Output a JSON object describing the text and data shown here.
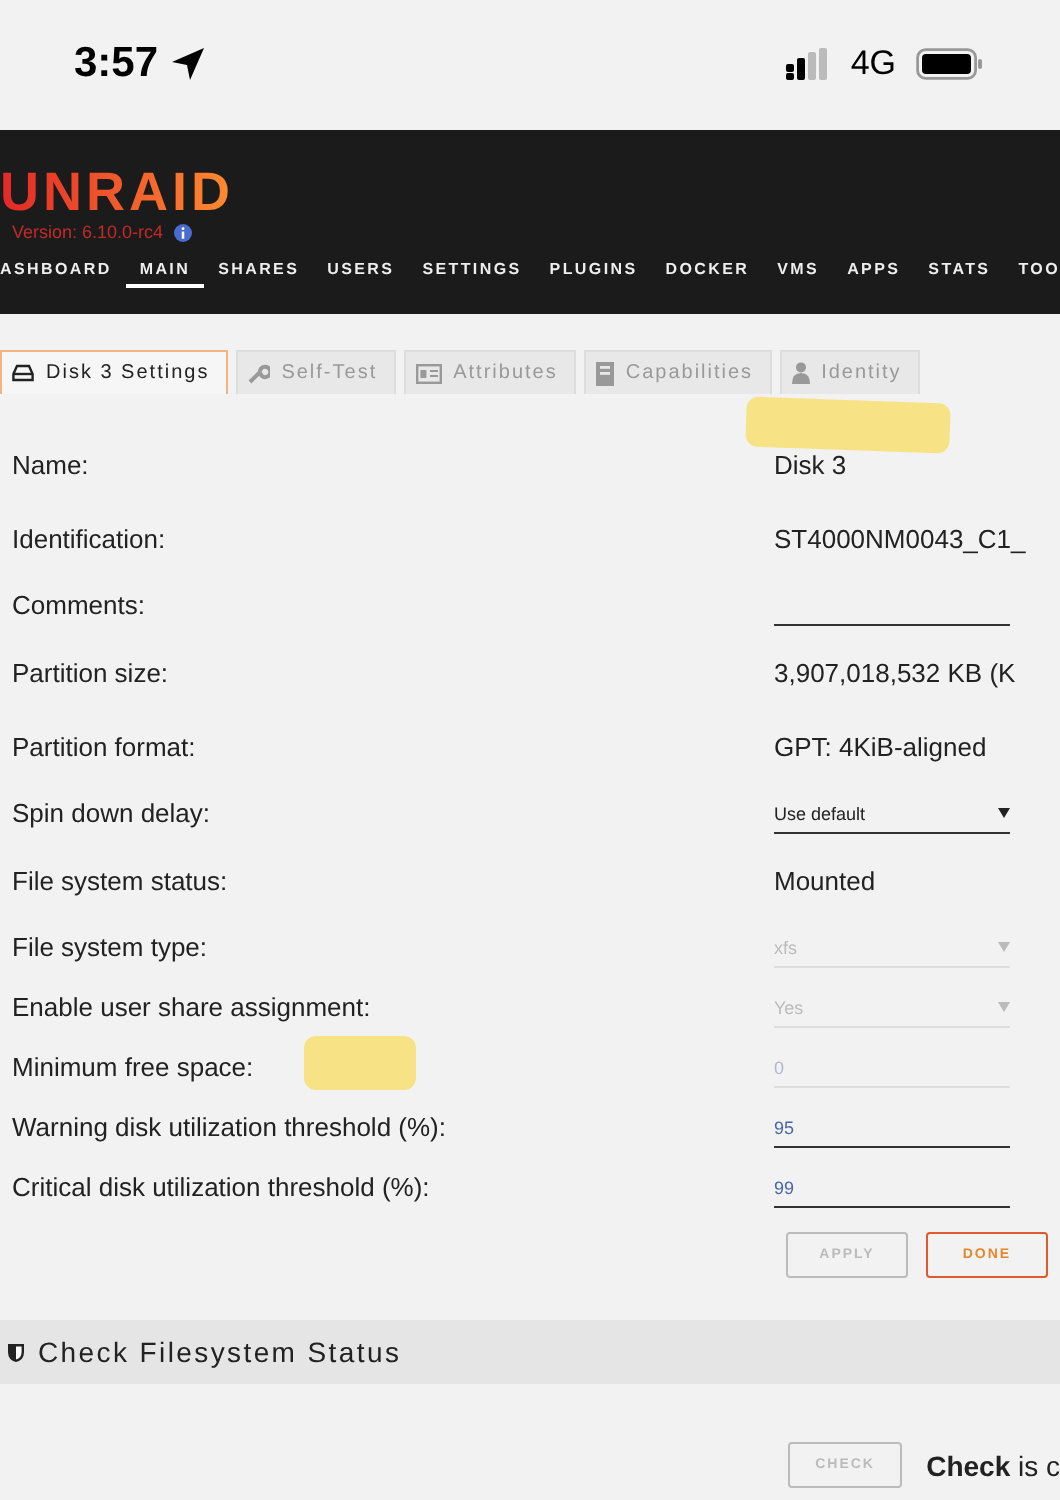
{
  "status_bar": {
    "time": "3:57",
    "network": "4G"
  },
  "header": {
    "logo": "UNRAID",
    "version": "Version: 6.10.0-rc4"
  },
  "nav": [
    {
      "label": "ASHBOARD",
      "selected": false
    },
    {
      "label": "MAIN",
      "selected": true
    },
    {
      "label": "SHARES",
      "selected": false
    },
    {
      "label": "USERS",
      "selected": false
    },
    {
      "label": "SETTINGS",
      "selected": false
    },
    {
      "label": "PLUGINS",
      "selected": false
    },
    {
      "label": "DOCKER",
      "selected": false
    },
    {
      "label": "VMS",
      "selected": false
    },
    {
      "label": "APPS",
      "selected": false
    },
    {
      "label": "STATS",
      "selected": false
    },
    {
      "label": "TOO",
      "selected": false
    }
  ],
  "tabs": [
    {
      "label": "Disk 3 Settings",
      "kind": "drive",
      "selected": true
    },
    {
      "label": "Self-Test",
      "kind": "wrench",
      "selected": false
    },
    {
      "label": "Attributes",
      "kind": "card",
      "selected": false
    },
    {
      "label": "Capabilities",
      "kind": "server",
      "selected": false
    },
    {
      "label": "Identity",
      "kind": "user",
      "selected": false
    }
  ],
  "settings": [
    {
      "label": "Name:",
      "kind": "text",
      "value": "Disk 3"
    },
    {
      "label": "Identification:",
      "kind": "text",
      "value": "ST4000NM0043_C1_"
    },
    {
      "label": "Comments:",
      "kind": "field"
    },
    {
      "label": "Partition size:",
      "kind": "text",
      "value": "3,907,018,532 KB (K"
    },
    {
      "label": "Partition format:",
      "kind": "text",
      "value": "GPT: 4KiB-aligned"
    },
    {
      "label": "Spin down delay:",
      "kind": "select",
      "value": "Use default",
      "disabled": false
    },
    {
      "label": "File system status:",
      "kind": "text",
      "value": "Mounted"
    },
    {
      "label": "File system type:",
      "kind": "select",
      "value": "xfs",
      "disabled": true
    },
    {
      "label": "Enable user share assignment:",
      "kind": "select",
      "value": "Yes",
      "disabled": true
    },
    {
      "label": "Minimum free space:",
      "kind": "field",
      "value": "0",
      "disabled": true
    },
    {
      "label": "Warning disk utilization threshold (%):",
      "kind": "field",
      "value": "95",
      "disabled": false
    },
    {
      "label": "Critical disk utilization threshold (%):",
      "kind": "field",
      "value": "99",
      "disabled": false
    }
  ],
  "buttons": [
    {
      "label": "APPLY",
      "disabled": true
    },
    {
      "label": "DONE",
      "disabled": false
    }
  ],
  "section": {
    "title": "Check Filesystem Status",
    "button": {
      "label": "CHECK",
      "disabled": true
    },
    "note": "**Check** is c"
  }
}
